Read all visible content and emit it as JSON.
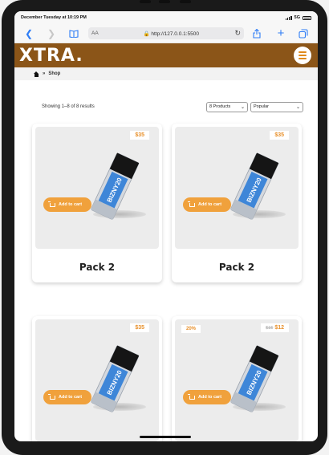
{
  "status_bar": {
    "datetime": "December Tuesday at 10:19 PM",
    "network": "5G"
  },
  "browser": {
    "text_size_label": "AA",
    "url": "http://127.0.0.1:5500"
  },
  "site": {
    "logo": "XTRA.",
    "accent_color": "#8b5518",
    "button_color": "#f0a13c"
  },
  "breadcrumb": {
    "separator": "»",
    "current": "Shop"
  },
  "toolbar": {
    "results_text": "Showing 1–8 of 8 results",
    "per_page_selected": "8 Products",
    "sort_selected": "Popular"
  },
  "products": [
    {
      "name": "Pack 2",
      "price": "$35",
      "add_to_cart": "Add to cart",
      "image_label": "BIZNY20"
    },
    {
      "name": "Pack 2",
      "price": "$35",
      "add_to_cart": "Add to cart",
      "image_label": "BIZNY20"
    },
    {
      "name": "",
      "price": "$35",
      "add_to_cart": "Add to cart",
      "image_label": "BIZNY20"
    },
    {
      "name": "",
      "price": "$12",
      "old_price": "$15",
      "discount": "20%",
      "add_to_cart": "Add to cart",
      "image_label": "BIZNY20"
    }
  ]
}
